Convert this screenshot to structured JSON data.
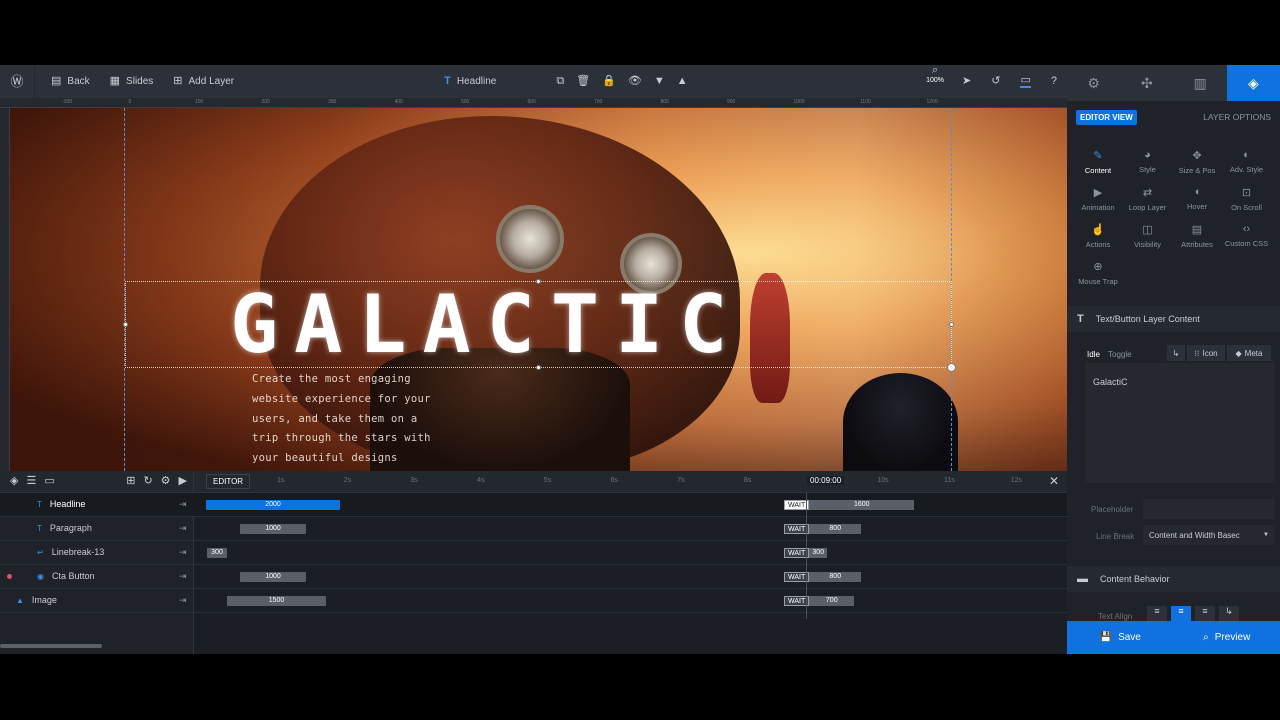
{
  "toolbar": {
    "back": "Back",
    "slides": "Slides",
    "add_layer": "Add Layer",
    "layer_name": "Headline",
    "zoom": "100%"
  },
  "ruler": {
    "h_ticks": [
      "-100",
      "0",
      "100",
      "200",
      "300",
      "400",
      "500",
      "600",
      "700",
      "800",
      "900",
      "1000",
      "1100",
      "1200"
    ]
  },
  "canvas": {
    "headline": "GALACTIC",
    "paragraph_lines": [
      "Create the most engaging",
      "website experience for your",
      "users, and take them on a",
      "trip through the stars with",
      "your beautiful designs"
    ]
  },
  "timeline": {
    "editor_label": "EDITOR",
    "time_ticks": [
      "1s",
      "2s",
      "3s",
      "4s",
      "5s",
      "6s",
      "7s",
      "8s",
      "9s",
      "10s",
      "11s",
      "12s"
    ],
    "current_time": "00:09:00",
    "wait_label": "WAIT",
    "layers": [
      {
        "name": "Headline",
        "icon": "T",
        "start": "2000",
        "end": "1600"
      },
      {
        "name": "Paragraph",
        "icon": "T",
        "start": "1000",
        "end": "800"
      },
      {
        "name": "Linebreak-13",
        "icon": "↵",
        "start": "300",
        "end": "300"
      },
      {
        "name": "Cta Button",
        "icon": "◉",
        "start": "1000",
        "end": "800"
      },
      {
        "name": "Image",
        "icon": "▲",
        "start": "1500",
        "end": "700"
      }
    ]
  },
  "panel": {
    "editor_view": "EDITOR VIEW",
    "layer_options": "LAYER OPTIONS",
    "options": [
      {
        "label": "Content",
        "icon": "✎"
      },
      {
        "label": "Style",
        "icon": "◕"
      },
      {
        "label": "Size & Pos",
        "icon": "✥"
      },
      {
        "label": "Adv. Style",
        "icon": "◐"
      },
      {
        "label": "Animation",
        "icon": "▶"
      },
      {
        "label": "Loop Layer",
        "icon": "⇄"
      },
      {
        "label": "Hover",
        "icon": "◖"
      },
      {
        "label": "On Scroll",
        "icon": "⊡"
      },
      {
        "label": "Actions",
        "icon": "☝"
      },
      {
        "label": "Visibility",
        "icon": "◫"
      },
      {
        "label": "Attributes",
        "icon": "▤"
      },
      {
        "label": "Custom CSS",
        "icon": "‹›"
      },
      {
        "label": "Mouse Trap",
        "icon": "⊕"
      }
    ],
    "section_content": "Text/Button Layer Content",
    "idle": "Idle",
    "toggle": "Toggle",
    "icon_btn": "Icon",
    "meta_btn": "Meta",
    "text_value": "GalactiC",
    "placeholder_label": "Placeholder",
    "linebreak_label": "Line Break",
    "linebreak_value": "Content and Width Basec",
    "section_behavior": "Content Behavior",
    "text_align_label": "Text Align",
    "save": "Save",
    "preview": "Preview"
  },
  "colors": {
    "accent": "#0f72de",
    "panel": "#1f2228",
    "toolbar": "#2c3038"
  }
}
